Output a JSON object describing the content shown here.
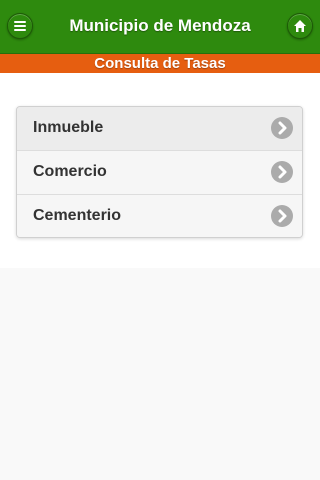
{
  "header": {
    "title": "Municipio de Mendoza",
    "menu_icon": "hamburger-menu-icon",
    "home_icon": "home-icon"
  },
  "subheader": {
    "title": "Consulta de Tasas"
  },
  "list": {
    "items": [
      {
        "label": "Inmueble",
        "icon": "chevron-right-icon"
      },
      {
        "label": "Comercio",
        "icon": "chevron-right-icon"
      },
      {
        "label": "Cementerio",
        "icon": "chevron-right-icon"
      }
    ]
  },
  "colors": {
    "header_bg": "#2e8a0e",
    "subheader_bg": "#e65e10",
    "page_bg": "#f9f9f9"
  }
}
